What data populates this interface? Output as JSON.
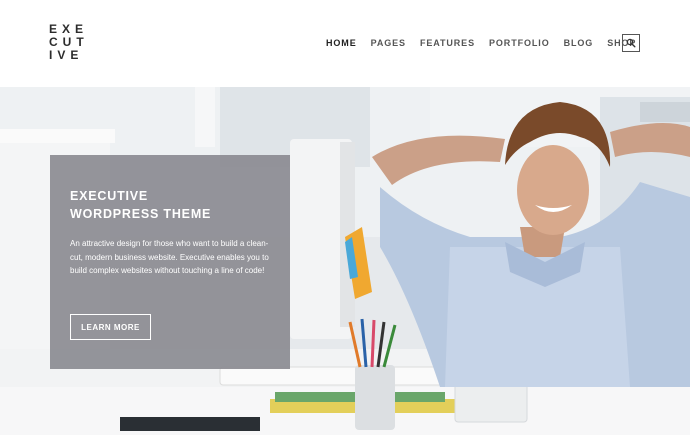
{
  "brand": {
    "logo_lines": [
      "EXE",
      "CUT",
      "IVE"
    ]
  },
  "nav": {
    "items": [
      {
        "label": "HOME",
        "active": true
      },
      {
        "label": "PAGES",
        "active": false
      },
      {
        "label": "FEATURES",
        "active": false
      },
      {
        "label": "PORTFOLIO",
        "active": false
      },
      {
        "label": "BLOG",
        "active": false
      },
      {
        "label": "SHOP",
        "active": false
      }
    ],
    "search_icon": "search-icon"
  },
  "hero": {
    "title_line_1": "EXECUTIVE",
    "title_line_2": "WORDPRESS THEME",
    "description": "An attractive design for those who want to build a clean-cut, modern business website. Executive enables you to build complex websites without touching a line of code!",
    "button_label": "LEARN MORE",
    "overlay_color": "#8c8c92"
  }
}
